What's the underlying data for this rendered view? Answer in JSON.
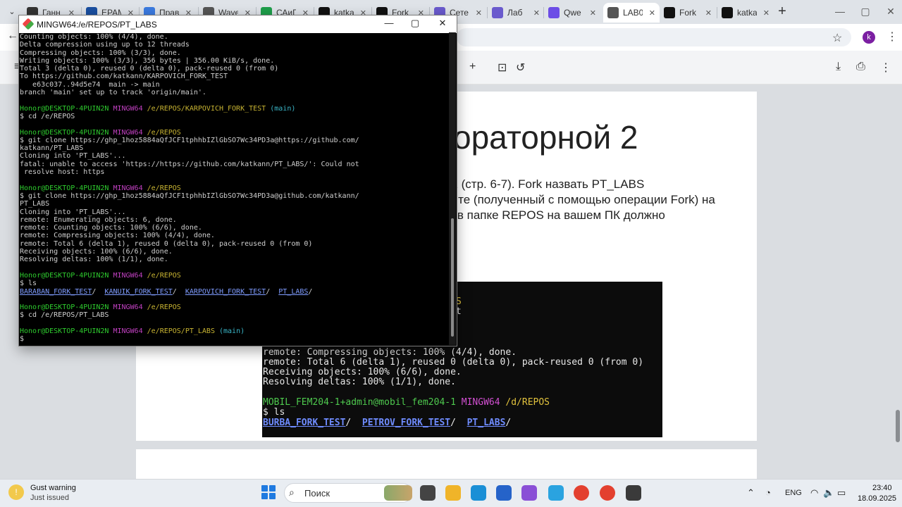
{
  "browser": {
    "tabs": [
      {
        "label": "Ганн",
        "icon": "person-icon",
        "color": "#333333"
      },
      {
        "label": "EPAM",
        "icon": "epam-icon",
        "color": "#1a4fa0"
      },
      {
        "label": "Прав",
        "icon": "doc-icon",
        "color": "#3b7be0"
      },
      {
        "label": "Wave",
        "icon": "globe-icon",
        "color": "#555555"
      },
      {
        "label": "САиГ",
        "icon": "plus-icon",
        "color": "#1e9e4a"
      },
      {
        "label": "katka",
        "icon": "github-icon",
        "color": "#111111"
      },
      {
        "label": "Fork",
        "icon": "github-icon",
        "color": "#111111"
      },
      {
        "label": "Сете",
        "icon": "vector-icon",
        "color": "#6a5acd"
      },
      {
        "label": "Лаб",
        "icon": "vector-icon",
        "color": "#6a5acd"
      },
      {
        "label": "Qwe",
        "icon": "qwen-icon",
        "color": "#6c4de6"
      },
      {
        "label": "LAB0",
        "icon": "globe-icon",
        "color": "#555555",
        "active": true
      },
      {
        "label": "Fork",
        "icon": "github-icon",
        "color": "#111111"
      },
      {
        "label": "katka",
        "icon": "github-icon",
        "color": "#111111"
      }
    ],
    "new_tab": "+",
    "avatar_letter": "k"
  },
  "pdf": {
    "title_fragment": "оратор­ной 2",
    "lines": [
      "ю 2 (стр. 6-7). Fork назвать PT_LABS",
      "аунте (полученный с помощью операции Fork) на",
      "ом в папке REPOS на вашем ПК должно"
    ],
    "image_lines": [
      {
        "parts": [
          {
            "t": "                    ",
            "c": ""
          },
          {
            "t": "MINGW64",
            "c": "m"
          },
          {
            "t": " /d/REPOS",
            "c": "y"
          }
        ]
      },
      {
        "parts": [
          {
            "t": "                    a-av/PT_LABS.git",
            "c": ""
          }
        ]
      },
      {
        "parts": [
          {
            "t": " ",
            "c": ""
          }
        ]
      },
      {
        "parts": [
          {
            "t": "                    ne.",
            "c": ""
          }
        ]
      },
      {
        "parts": [
          {
            "t": "                    ), done.",
            "c": ""
          }
        ]
      },
      {
        "parts": [
          {
            "t": "remote: Compressing objects: 100% (4/4), done.",
            "c": ""
          }
        ]
      },
      {
        "parts": [
          {
            "t": "remote: Total 6 (delta 1), reused 0 (delta 0), pack-reused 0 (from 0)",
            "c": ""
          }
        ]
      },
      {
        "parts": [
          {
            "t": "Receiving objects: 100% (6/6), done.",
            "c": ""
          }
        ]
      },
      {
        "parts": [
          {
            "t": "Resolving deltas: 100% (1/1), done.",
            "c": ""
          }
        ]
      },
      {
        "parts": [
          {
            "t": " ",
            "c": ""
          }
        ]
      },
      {
        "parts": [
          {
            "t": "MOBIL_FEM204-1+admin@mobil_fem204-1",
            "c": "g"
          },
          {
            "t": " MINGW64",
            "c": "m"
          },
          {
            "t": " /d/REPOS",
            "c": "y"
          }
        ]
      },
      {
        "parts": [
          {
            "t": "$ ls",
            "c": ""
          }
        ]
      },
      {
        "parts": [
          {
            "t": "BURBA_FORK_TEST",
            "c": "b"
          },
          {
            "t": "/  ",
            "c": ""
          },
          {
            "t": "PETROV_FORK_TEST",
            "c": "b"
          },
          {
            "t": "/  ",
            "c": ""
          },
          {
            "t": "PT_LABS",
            "c": "b"
          },
          {
            "t": "/",
            "c": ""
          }
        ]
      }
    ]
  },
  "terminal": {
    "title": "MINGW64:/e/REPOS/PT_LABS",
    "lines": [
      [
        {
          "t": "Counting objects: 100% (4/4), done.",
          "c": ""
        }
      ],
      [
        {
          "t": "Delta compression using up to 12 threads",
          "c": ""
        }
      ],
      [
        {
          "t": "Compressing objects: 100% (3/3), done.",
          "c": ""
        }
      ],
      [
        {
          "t": "Writing objects: 100% (3/3), 356 bytes | 356.00 KiB/s, done.",
          "c": ""
        }
      ],
      [
        {
          "t": "Total 3 (delta 0), reused 0 (delta 0), pack-reused 0 (from 0)",
          "c": ""
        }
      ],
      [
        {
          "t": "To https://github.com/katkann/KARPOVICH_FORK_TEST",
          "c": ""
        }
      ],
      [
        {
          "t": "   e63c037..94d5e74  main -> main",
          "c": ""
        }
      ],
      [
        {
          "t": "branch 'main' set up to track 'origin/main'.",
          "c": ""
        }
      ],
      [
        {
          "t": "",
          "c": ""
        }
      ],
      [
        {
          "t": "Honor@DESKTOP-4PUIN2N",
          "c": "tg"
        },
        {
          "t": " MINGW64",
          "c": "tm"
        },
        {
          "t": " /e/REPOS/KARPOVICH_FORK_TEST",
          "c": "ty"
        },
        {
          "t": " (main)",
          "c": "tc"
        }
      ],
      [
        {
          "t": "$ cd /e/REPOS",
          "c": ""
        }
      ],
      [
        {
          "t": "",
          "c": ""
        }
      ],
      [
        {
          "t": "Honor@DESKTOP-4PUIN2N",
          "c": "tg"
        },
        {
          "t": " MINGW64",
          "c": "tm"
        },
        {
          "t": " /e/REPOS",
          "c": "ty"
        }
      ],
      [
        {
          "t": "$ git clone https://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@https://github.com/",
          "c": ""
        }
      ],
      [
        {
          "t": "katkann/PT_LABS",
          "c": ""
        }
      ],
      [
        {
          "t": "Cloning into 'PT_LABS'...",
          "c": ""
        }
      ],
      [
        {
          "t": "fatal: unable to access 'https://https://github.com/katkann/PT_LABS/': Could not",
          "c": ""
        }
      ],
      [
        {
          "t": " resolve host: https",
          "c": ""
        }
      ],
      [
        {
          "t": "",
          "c": ""
        }
      ],
      [
        {
          "t": "Honor@DESKTOP-4PUIN2N",
          "c": "tg"
        },
        {
          "t": " MINGW64",
          "c": "tm"
        },
        {
          "t": " /e/REPOS",
          "c": "ty"
        }
      ],
      [
        {
          "t": "$ git clone https://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@github.com/katkann/",
          "c": ""
        }
      ],
      [
        {
          "t": "PT_LABS",
          "c": ""
        }
      ],
      [
        {
          "t": "Cloning into 'PT_LABS'...",
          "c": ""
        }
      ],
      [
        {
          "t": "remote: Enumerating objects: 6, done.",
          "c": ""
        }
      ],
      [
        {
          "t": "remote: Counting objects: 100% (6/6), done.",
          "c": ""
        }
      ],
      [
        {
          "t": "remote: Compressing objects: 100% (4/4), done.",
          "c": ""
        }
      ],
      [
        {
          "t": "remote: Total 6 (delta 1), reused 0 (delta 0), pack-reused 0 (from 0)",
          "c": ""
        }
      ],
      [
        {
          "t": "Receiving objects: 100% (6/6), done.",
          "c": ""
        }
      ],
      [
        {
          "t": "Resolving deltas: 100% (1/1), done.",
          "c": ""
        }
      ],
      [
        {
          "t": "",
          "c": ""
        }
      ],
      [
        {
          "t": "Honor@DESKTOP-4PUIN2N",
          "c": "tg"
        },
        {
          "t": " MINGW64",
          "c": "tm"
        },
        {
          "t": " /e/REPOS",
          "c": "ty"
        }
      ],
      [
        {
          "t": "$ ls",
          "c": ""
        }
      ],
      [
        {
          "t": "BARABAN_FORK_TEST",
          "c": "tb"
        },
        {
          "t": "/  ",
          "c": ""
        },
        {
          "t": "KANUIK_FORK_TEST",
          "c": "tb"
        },
        {
          "t": "/  ",
          "c": ""
        },
        {
          "t": "KARPOVICH_FORK_TEST",
          "c": "tb"
        },
        {
          "t": "/  ",
          "c": ""
        },
        {
          "t": "PT_LABS",
          "c": "tb"
        },
        {
          "t": "/",
          "c": ""
        }
      ],
      [
        {
          "t": "",
          "c": ""
        }
      ],
      [
        {
          "t": "Honor@DESKTOP-4PUIN2N",
          "c": "tg"
        },
        {
          "t": " MINGW64",
          "c": "tm"
        },
        {
          "t": " /e/REPOS",
          "c": "ty"
        }
      ],
      [
        {
          "t": "$ cd /e/REPOS/PT_LABS",
          "c": ""
        }
      ],
      [
        {
          "t": "",
          "c": ""
        }
      ],
      [
        {
          "t": "Honor@DESKTOP-4PUIN2N",
          "c": "tg"
        },
        {
          "t": " MINGW64",
          "c": "tm"
        },
        {
          "t": " /e/REPOS/PT_LABS",
          "c": "ty"
        },
        {
          "t": " (main)",
          "c": "tc"
        }
      ],
      [
        {
          "t": "$",
          "c": ""
        }
      ]
    ]
  },
  "taskbar": {
    "weather_title": "Gust warning",
    "weather_sub": "Just issued",
    "search_label": "Поиск",
    "lang": "ENG",
    "time": "23:40",
    "date": "18.09.2025",
    "pinned": [
      {
        "name": "file-explorer-icon",
        "color": "#f0b429"
      },
      {
        "name": "edge-icon",
        "color": "#1a8fd6"
      },
      {
        "name": "store-icon",
        "color": "#2563c9"
      },
      {
        "name": "visual-studio-icon",
        "color": "#8a4fd6"
      },
      {
        "name": "telegram-icon",
        "color": "#2aa3e0"
      },
      {
        "name": "chrome-icon",
        "color": "#e3402f"
      },
      {
        "name": "chrome-alt-icon",
        "color": "#e3402f"
      },
      {
        "name": "git-bash-icon",
        "color": "#3a3a3a"
      }
    ]
  }
}
